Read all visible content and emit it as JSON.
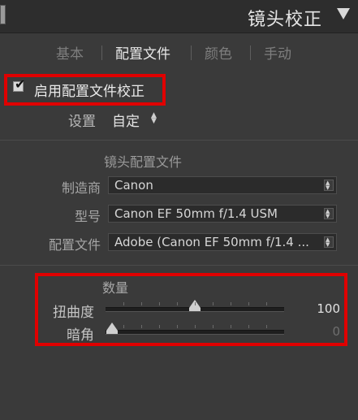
{
  "header": {
    "title": "镜头校正",
    "collapse_icon": "triangle-down-icon"
  },
  "tabs": [
    {
      "label": "基本",
      "active": false
    },
    {
      "label": "配置文件",
      "active": true
    },
    {
      "label": "颜色",
      "active": false
    },
    {
      "label": "手动",
      "active": false
    }
  ],
  "enable_profile": {
    "checked": true,
    "label": "启用配置文件校正"
  },
  "setup": {
    "label": "设置",
    "value": "自定"
  },
  "lens_profile": {
    "title": "镜头配置文件",
    "make_label": "制造商",
    "make_value": "Canon",
    "model_label": "型号",
    "model_value": "Canon EF 50mm f/1.4 USM",
    "profile_label": "配置文件",
    "profile_value": "Adobe (Canon EF 50mm f/1.4 ..."
  },
  "amount": {
    "title": "数量",
    "distortion_label": "扭曲度",
    "distortion_value": "100",
    "distortion_level": 100,
    "vignetting_label": "暗角",
    "vignetting_value": "0",
    "vignetting_level": 0,
    "slider_max": 200
  },
  "colors": {
    "highlight": "#e00000",
    "panel_bg": "#3a3a3a",
    "header_bg": "#2d2d2d"
  }
}
